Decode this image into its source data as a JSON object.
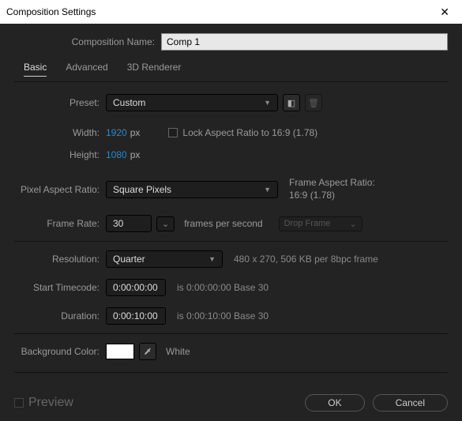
{
  "window": {
    "title": "Composition Settings"
  },
  "name": {
    "label": "Composition Name:",
    "value": "Comp 1"
  },
  "tabs": {
    "basic": "Basic",
    "advanced": "Advanced",
    "renderer": "3D Renderer"
  },
  "preset": {
    "label": "Preset:",
    "value": "Custom"
  },
  "width": {
    "label": "Width:",
    "value": "1920",
    "unit": "px"
  },
  "height": {
    "label": "Height:",
    "value": "1080",
    "unit": "px"
  },
  "lockAspect": {
    "label": "Lock Aspect Ratio to 16:9 (1.78)"
  },
  "pixelAspect": {
    "label": "Pixel Aspect Ratio:",
    "value": "Square Pixels"
  },
  "frameAspect": {
    "label": "Frame Aspect Ratio:",
    "value": "16:9 (1.78)"
  },
  "frameRate": {
    "label": "Frame Rate:",
    "value": "30",
    "fps": "frames per second",
    "drop": "Drop Frame"
  },
  "resolution": {
    "label": "Resolution:",
    "value": "Quarter",
    "hint": "480 x 270, 506 KB per 8bpc frame"
  },
  "startTimecode": {
    "label": "Start Timecode:",
    "value": "0:00:00:00",
    "hint": "is 0:00:00:00 Base 30"
  },
  "duration": {
    "label": "Duration:",
    "value": "0:00:10:00",
    "hint": "is 0:00:10:00 Base 30"
  },
  "bgcolor": {
    "label": "Background Color:",
    "name": "White"
  },
  "footer": {
    "preview": "Preview",
    "ok": "OK",
    "cancel": "Cancel"
  }
}
